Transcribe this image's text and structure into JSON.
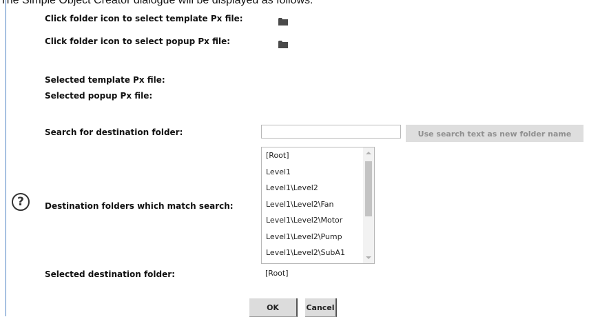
{
  "intro_text": "The Simple Object Creator dialogue will be displayed as follows:",
  "template_prompt": "Click folder icon to select template Px file:",
  "popup_prompt": "Click folder icon to select popup Px file:",
  "selected_template_label": "Selected template Px file:",
  "selected_popup_label": "Selected popup Px file:",
  "search_label": "Search for destination folder:",
  "search_value": "",
  "search_placeholder": "",
  "new_folder_button": "Use search text as new folder name",
  "folders_label": "Destination folders which match search:",
  "folders": [
    "[Root]",
    "Level1",
    "Level1\\Level2",
    "Level1\\Level2\\Fan",
    "Level1\\Level2\\Motor",
    "Level1\\Level2\\Pump",
    "Level1\\Level2\\SubA1"
  ],
  "selected_dest_label": "Selected destination folder:",
  "selected_dest_value": "[Root]",
  "ok_button": "OK",
  "cancel_button": "Cancel",
  "icons": {
    "folder": "folder-icon",
    "help": "help-icon",
    "scroll_up": "scroll-up-arrow",
    "scroll_down": "scroll-down-arrow"
  },
  "help_glyph": "?"
}
